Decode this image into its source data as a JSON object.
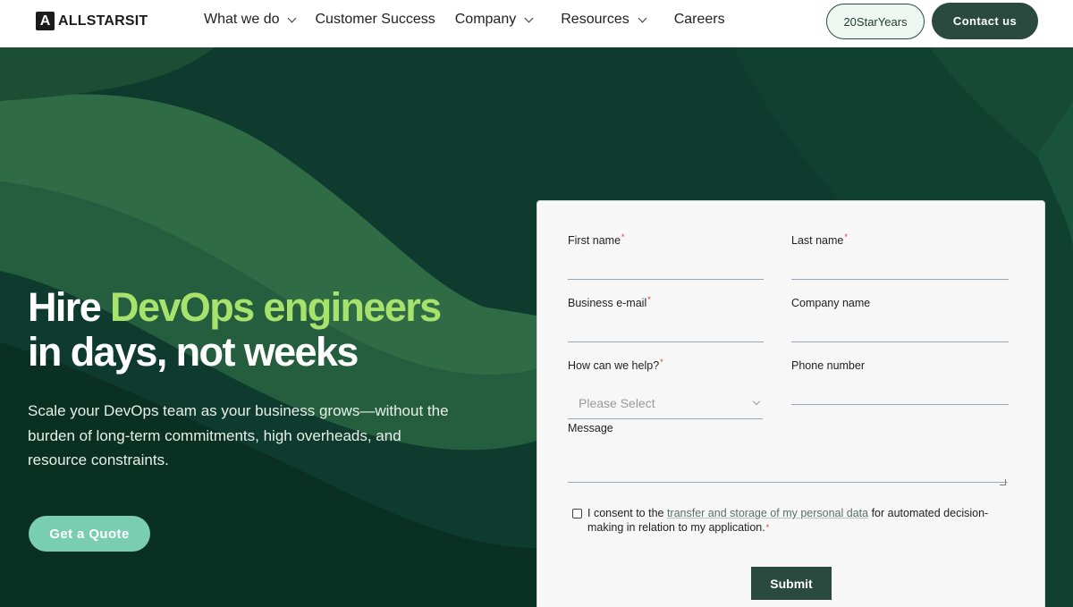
{
  "header": {
    "logo_mark": "A",
    "logo_text": "ALLSTARSIT",
    "nav": [
      {
        "label": "What we do",
        "has_dropdown": true
      },
      {
        "label": "Customer Success",
        "has_dropdown": false
      },
      {
        "label": "Company",
        "has_dropdown": true
      },
      {
        "label": "Resources",
        "has_dropdown": true
      },
      {
        "label": "Careers",
        "has_dropdown": false
      }
    ],
    "years_button": "20StarYears",
    "contact_button": "Contact us"
  },
  "hero": {
    "headline_start": "Hire ",
    "headline_accent": "DevOps engineers",
    "headline_end": "in days, not weeks",
    "subtext": "Scale your DevOps team as your business grows—without the burden of long-term commitments, high overheads, and resource constraints.",
    "cta": "Get a Quote"
  },
  "form": {
    "first_name": {
      "label": "First name",
      "required": "*",
      "value": ""
    },
    "last_name": {
      "label": "Last name",
      "required": "*",
      "value": ""
    },
    "business_email": {
      "label": "Business e-mail",
      "required": "*",
      "value": ""
    },
    "company_name": {
      "label": "Company name",
      "value": ""
    },
    "how_help": {
      "label": "How can we help?",
      "required": "*",
      "selected": "Please Select"
    },
    "phone": {
      "label": "Phone number",
      "value": ""
    },
    "message": {
      "label": "Message",
      "value": ""
    },
    "consent": {
      "prefix": "I consent to the ",
      "link": "transfer and storage of my personal data",
      "suffix": " for automated decision-making in relation to my application.",
      "required": "*",
      "checked": false
    },
    "submit": "Submit"
  },
  "colors": {
    "brand_dark": "#2a4a40",
    "hero_bg": "#0d3a2c",
    "accent_green": "#a6e26c",
    "cta_teal": "#79cdb0",
    "required_red": "#e0342b"
  }
}
